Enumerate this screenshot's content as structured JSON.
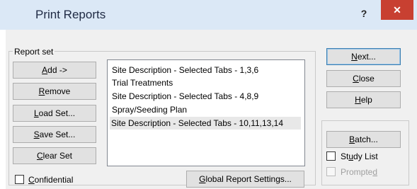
{
  "window": {
    "title": "Print Reports",
    "help_glyph": "?",
    "close_glyph": "✕"
  },
  "report_set": {
    "label": "Report set",
    "buttons": {
      "add": {
        "pre": "",
        "u": "A",
        "post": "dd ->"
      },
      "remove": {
        "pre": "",
        "u": "R",
        "post": "emove"
      },
      "load_set": {
        "pre": "",
        "u": "L",
        "post": "oad Set..."
      },
      "save_set": {
        "pre": "",
        "u": "S",
        "post": "ave Set..."
      },
      "clear_set": {
        "pre": "",
        "u": "C",
        "post": "lear Set"
      }
    },
    "items": [
      "Site Description - Selected Tabs - 1,3,6",
      "Trial Treatments",
      "Site Description - Selected Tabs - 4,8,9",
      "Spray/Seeding Plan",
      "Site Description - Selected Tabs - 10,11,13,14"
    ],
    "selected_index": 4,
    "confidential": {
      "pre": "",
      "u": "C",
      "post": "onfidential",
      "checked": false
    },
    "global_settings": {
      "pre": "",
      "u": "G",
      "post": "lobal Report Settings..."
    }
  },
  "side_buttons": {
    "next": {
      "pre": "",
      "u": "N",
      "post": "ext..."
    },
    "close": {
      "pre": "",
      "u": "C",
      "post": "lose"
    },
    "help": {
      "pre": "",
      "u": "H",
      "post": "elp"
    }
  },
  "batch": {
    "button": {
      "pre": "",
      "u": "B",
      "post": "atch..."
    },
    "study_list": {
      "pre": "St",
      "u": "u",
      "post": "dy List",
      "checked": false
    },
    "prompted": {
      "pre": "Prompte",
      "u": "d",
      "post": "",
      "checked": false,
      "enabled": false
    }
  },
  "colors": {
    "title_bg": "#dbe8f6",
    "close_bg": "#c84031",
    "client_bg": "#f0f0f0"
  }
}
